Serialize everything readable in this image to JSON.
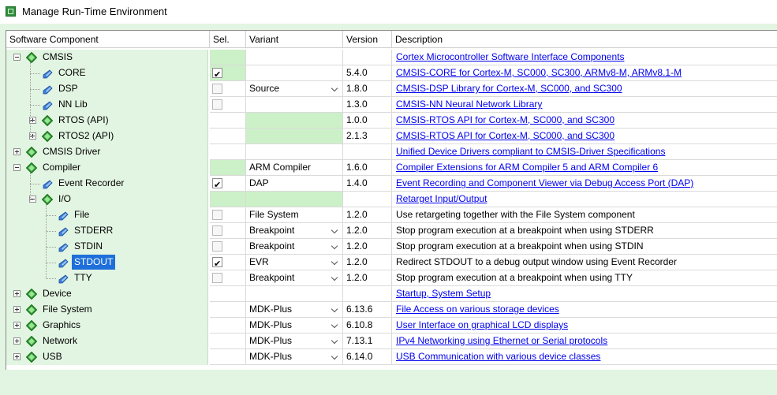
{
  "window": {
    "title": "Manage Run-Time Environment"
  },
  "columns": {
    "component": "Software Component",
    "sel": "Sel.",
    "variant": "Variant",
    "version": "Version",
    "description": "Description"
  },
  "rows": [
    {
      "name": "CMSIS",
      "level": 0,
      "expander": "minus",
      "icon": "gem-icon",
      "sel": "",
      "selbg": "green",
      "variant": "",
      "varbg": "",
      "dropdown": false,
      "version": "",
      "description": "Cortex Microcontroller Software Interface Components",
      "link": true
    },
    {
      "name": "CORE",
      "level": 1,
      "expander": "",
      "icon": "component-pin-icon",
      "sel": "checked",
      "selbg": "green",
      "variant": "",
      "varbg": "",
      "dropdown": false,
      "version": "5.4.0",
      "description": "CMSIS-CORE for Cortex-M, SC000, SC300, ARMv8-M, ARMv8.1-M",
      "link": true
    },
    {
      "name": "DSP",
      "level": 1,
      "expander": "",
      "icon": "component-pin-icon",
      "sel": "unchecked",
      "selbg": "",
      "variant": "Source",
      "varbg": "",
      "dropdown": true,
      "version": "1.8.0",
      "description": "CMSIS-DSP Library for Cortex-M, SC000, and SC300",
      "link": true
    },
    {
      "name": "NN Lib",
      "level": 1,
      "expander": "",
      "icon": "component-pin-icon",
      "sel": "unchecked",
      "selbg": "",
      "variant": "",
      "varbg": "",
      "dropdown": false,
      "version": "1.3.0",
      "description": "CMSIS-NN Neural Network Library",
      "link": true
    },
    {
      "name": "RTOS (API)",
      "level": 1,
      "expander": "plus",
      "icon": "gem-icon",
      "sel": "",
      "selbg": "",
      "variant": "",
      "varbg": "green",
      "dropdown": false,
      "version": "1.0.0",
      "description": "CMSIS-RTOS API for Cortex-M, SC000, and SC300",
      "link": true
    },
    {
      "name": "RTOS2 (API)",
      "level": 1,
      "expander": "plus",
      "icon": "gem-icon",
      "sel": "",
      "selbg": "",
      "variant": "",
      "varbg": "green",
      "dropdown": false,
      "version": "2.1.3",
      "description": "CMSIS-RTOS API for Cortex-M, SC000, and SC300",
      "link": true
    },
    {
      "name": "CMSIS Driver",
      "level": 0,
      "expander": "plus",
      "icon": "gem-icon",
      "sel": "",
      "selbg": "",
      "variant": "",
      "varbg": "",
      "dropdown": false,
      "version": "",
      "description": "Unified Device Drivers compliant to CMSIS-Driver Specifications",
      "link": true
    },
    {
      "name": "Compiler",
      "level": 0,
      "expander": "minus",
      "icon": "gem-icon",
      "sel": "",
      "selbg": "green",
      "variant": "ARM Compiler",
      "varbg": "",
      "dropdown": false,
      "version": "1.6.0",
      "description": "Compiler Extensions for ARM Compiler 5 and ARM Compiler 6",
      "link": true
    },
    {
      "name": "Event Recorder",
      "level": 1,
      "expander": "",
      "icon": "component-pin-icon",
      "sel": "checked",
      "selbg": "",
      "variant": "DAP",
      "varbg": "",
      "dropdown": false,
      "version": "1.4.0",
      "description": "Event Recording and Component Viewer via Debug Access Port (DAP)",
      "link": true
    },
    {
      "name": "I/O",
      "level": 1,
      "expander": "minus",
      "icon": "gem-icon",
      "sel": "",
      "selbg": "green",
      "variant": "",
      "varbg": "green",
      "dropdown": false,
      "version": "",
      "description": "Retarget Input/Output",
      "link": true
    },
    {
      "name": "File",
      "level": 2,
      "expander": "",
      "icon": "component-pin-icon",
      "sel": "unchecked",
      "selbg": "",
      "variant": "File System",
      "varbg": "",
      "dropdown": false,
      "version": "1.2.0",
      "description": "Use retargeting together with the File System component",
      "link": false
    },
    {
      "name": "STDERR",
      "level": 2,
      "expander": "",
      "icon": "component-pin-icon",
      "sel": "unchecked",
      "selbg": "",
      "variant": "Breakpoint",
      "varbg": "",
      "dropdown": true,
      "version": "1.2.0",
      "description": "Stop program execution at a breakpoint when using STDERR",
      "link": false
    },
    {
      "name": "STDIN",
      "level": 2,
      "expander": "",
      "icon": "component-pin-icon",
      "sel": "unchecked",
      "selbg": "",
      "variant": "Breakpoint",
      "varbg": "",
      "dropdown": true,
      "version": "1.2.0",
      "description": "Stop program execution at a breakpoint when using STDIN",
      "link": false
    },
    {
      "name": "STDOUT",
      "level": 2,
      "expander": "",
      "icon": "component-pin-icon",
      "sel": "checked",
      "selbg": "",
      "variant": "EVR",
      "varbg": "",
      "dropdown": true,
      "version": "1.2.0",
      "description": "Redirect STDOUT to a debug output window using Event Recorder",
      "link": false,
      "selected": true
    },
    {
      "name": "TTY",
      "level": 2,
      "expander": "",
      "icon": "component-pin-icon",
      "sel": "unchecked",
      "selbg": "",
      "variant": "Breakpoint",
      "varbg": "",
      "dropdown": true,
      "version": "1.2.0",
      "description": "Stop program execution at a breakpoint when using TTY",
      "link": false
    },
    {
      "name": "Device",
      "level": 0,
      "expander": "plus",
      "icon": "gem-icon",
      "sel": "",
      "selbg": "",
      "variant": "",
      "varbg": "",
      "dropdown": false,
      "version": "",
      "description": "Startup, System Setup",
      "link": true
    },
    {
      "name": "File System",
      "level": 0,
      "expander": "plus",
      "icon": "gem-icon",
      "sel": "",
      "selbg": "",
      "variant": "MDK-Plus",
      "varbg": "",
      "dropdown": true,
      "version": "6.13.6",
      "description": "File Access on various storage devices",
      "link": true
    },
    {
      "name": "Graphics",
      "level": 0,
      "expander": "plus",
      "icon": "gem-icon",
      "sel": "",
      "selbg": "",
      "variant": "MDK-Plus",
      "varbg": "",
      "dropdown": true,
      "version": "6.10.8",
      "description": "User Interface on graphical LCD displays",
      "link": true
    },
    {
      "name": "Network",
      "level": 0,
      "expander": "plus",
      "icon": "gem-icon",
      "sel": "",
      "selbg": "",
      "variant": "MDK-Plus",
      "varbg": "",
      "dropdown": true,
      "version": "7.13.1",
      "description": "IPv4 Networking using Ethernet or Serial protocols",
      "link": true
    },
    {
      "name": "USB",
      "level": 0,
      "expander": "plus",
      "icon": "gem-icon",
      "sel": "",
      "selbg": "",
      "variant": "MDK-Plus",
      "varbg": "",
      "dropdown": true,
      "version": "6.14.0",
      "description": "USB Communication with various device classes",
      "link": true
    }
  ],
  "colors": {
    "panel_green": "#e2f5e2",
    "cell_green": "#ccf0c8",
    "selection": "#1e6fd9",
    "link": "#0000ee"
  }
}
